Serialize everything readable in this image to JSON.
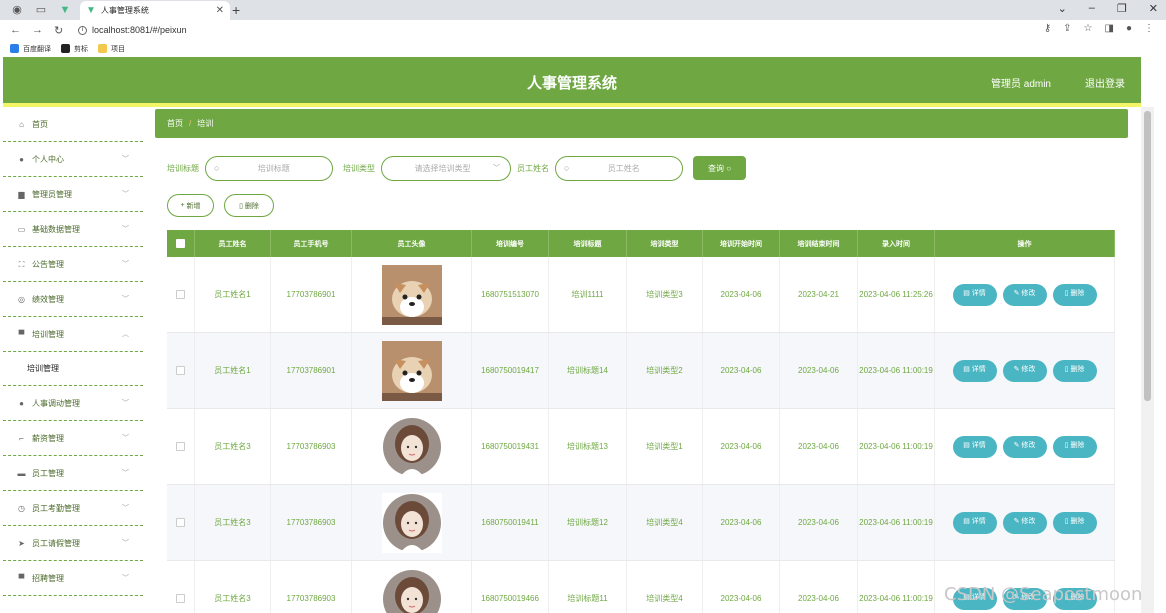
{
  "browser": {
    "tab_title": "人事管理系统",
    "url": "localhost:8081/#/peixun",
    "bookmarks": [
      "百度翻译",
      "剪标",
      "项目"
    ]
  },
  "header": {
    "title": "人事管理系统",
    "user_label": "管理员 admin",
    "logout_label": "退出登录"
  },
  "sidebar": {
    "items": [
      {
        "label": "首页",
        "icon": "home-icon"
      },
      {
        "label": "个人中心",
        "icon": "user-icon"
      },
      {
        "label": "管理员管理",
        "icon": "trash-icon"
      },
      {
        "label": "基础数据管理",
        "icon": "box-icon"
      },
      {
        "label": "公告管理",
        "icon": "frame-icon"
      },
      {
        "label": "绩效管理",
        "icon": "compass-icon"
      },
      {
        "label": "培训管理",
        "icon": "monitor-icon",
        "expanded": true,
        "sub": "培训管理"
      },
      {
        "label": "人事调动管理",
        "icon": "user-icon"
      },
      {
        "label": "薪资管理",
        "icon": "crop-icon"
      },
      {
        "label": "员工管理",
        "icon": "ticket-icon"
      },
      {
        "label": "员工考勤管理",
        "icon": "clock-icon"
      },
      {
        "label": "员工请假管理",
        "icon": "send-icon"
      },
      {
        "label": "招聘管理",
        "icon": "post-icon"
      }
    ]
  },
  "breadcrumb": {
    "home": "首页",
    "sep": "/",
    "current": "培训"
  },
  "search": {
    "title_label": "培训标题",
    "title_placeholder": "培训标题",
    "type_label": "培训类型",
    "type_placeholder": "请选择培训类型",
    "name_label": "员工姓名",
    "name_placeholder": "员工姓名",
    "search_button": "查询"
  },
  "actions": {
    "add": "新增",
    "delete": "删除"
  },
  "table": {
    "headers": [
      "员工姓名",
      "员工手机号",
      "员工头像",
      "培训编号",
      "培训标题",
      "培训类型",
      "培训开始时间",
      "培训结束时间",
      "录入时间",
      "操作"
    ],
    "buttons": {
      "detail": "详情",
      "edit": "修改",
      "delete": "删除"
    },
    "rows": [
      {
        "name": "员工姓名1",
        "phone": "17703786901",
        "avatar": "dog",
        "no": "1680751513070",
        "title": "培训1111",
        "type": "培训类型3",
        "start": "2023-04-06",
        "end": "2023-04-21",
        "created": "2023-04-06 11:25:26"
      },
      {
        "name": "员工姓名1",
        "phone": "17703786901",
        "avatar": "dog",
        "no": "1680750019417",
        "title": "培训标题14",
        "type": "培训类型2",
        "start": "2023-04-06",
        "end": "2023-04-06",
        "created": "2023-04-06 11:00:19"
      },
      {
        "name": "员工姓名3",
        "phone": "17703786903",
        "avatar": "girl",
        "no": "1680750019431",
        "title": "培训标题13",
        "type": "培训类型1",
        "start": "2023-04-06",
        "end": "2023-04-06",
        "created": "2023-04-06 11:00:19"
      },
      {
        "name": "员工姓名3",
        "phone": "17703786903",
        "avatar": "girl",
        "no": "1680750019411",
        "title": "培训标题12",
        "type": "培训类型4",
        "start": "2023-04-06",
        "end": "2023-04-06",
        "created": "2023-04-06 11:00:19"
      },
      {
        "name": "员工姓名3",
        "phone": "17703786903",
        "avatar": "girl",
        "no": "1680750019466",
        "title": "培训标题11",
        "type": "培训类型4",
        "start": "2023-04-06",
        "end": "2023-04-06",
        "created": "2023-04-06 11:00:19"
      }
    ]
  },
  "watermark": "CSDN @Seapostmoon",
  "colors": {
    "primary": "#6fa843",
    "accent_bar": "#f4f467",
    "op_button": "#4ab6c3"
  }
}
